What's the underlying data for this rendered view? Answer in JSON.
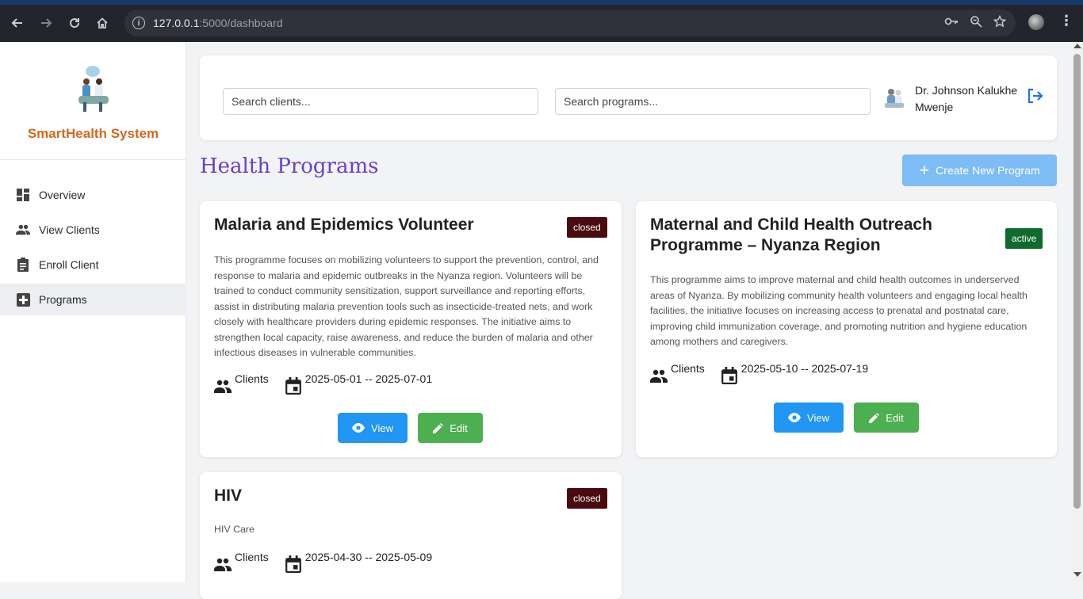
{
  "browser": {
    "url_host": "127.0.0.1",
    "url_rest": ":5000/dashboard",
    "icons": [
      "back-icon",
      "forward-icon",
      "reload-icon",
      "home-icon",
      "site-info-icon",
      "password-key-icon",
      "zoom-icon",
      "bookmark-star-icon",
      "profile-avatar",
      "chrome-menu-icon"
    ]
  },
  "sidebar": {
    "brand": "SmartHealth System",
    "items": [
      {
        "label": "Overview",
        "icon": "dashboard-icon"
      },
      {
        "label": "View Clients",
        "icon": "people-icon"
      },
      {
        "label": "Enroll Client",
        "icon": "clipboard-icon"
      },
      {
        "label": "Programs",
        "icon": "medical-plus-icon",
        "active": true
      }
    ]
  },
  "header": {
    "search_clients_placeholder": "Search clients...",
    "search_programs_placeholder": "Search programs...",
    "doctor_name": "Dr. Johnson Kalukhe Mwenje"
  },
  "main": {
    "title": "Health Programs",
    "create_button": "Create New Program",
    "view_label": "View",
    "edit_label": "Edit",
    "clients_label": "Clients",
    "programs": [
      {
        "name": "Malaria and Epidemics Volunteer",
        "status": "closed",
        "description": "This programme focuses on mobilizing volunteers to support the prevention, control, and response to malaria and epidemic outbreaks in the Nyanza region. Volunteers will be trained to conduct community sensitization, support surveillance and reporting efforts, assist in distributing malaria prevention tools such as insecticide-treated nets, and work closely with healthcare providers during epidemic responses. The initiative aims to strengthen local capacity, raise awareness, and reduce the burden of malaria and other infectious diseases in vulnerable communities.",
        "dates": "2025-05-01 -- 2025-07-01"
      },
      {
        "name": "Maternal and Child Health Outreach Programme – Nyanza Region",
        "status": "active",
        "description": "This programme aims to improve maternal and child health outcomes in underserved areas of Nyanza. By mobilizing community health volunteers and engaging local health facilities, the initiative focuses on increasing access to prenatal and postnatal care, improving child immunization coverage, and promoting nutrition and hygiene education among mothers and caregivers.",
        "dates": "2025-05-10 -- 2025-07-19"
      },
      {
        "name": "HIV",
        "status": "closed",
        "description": "HIV Care",
        "dates": "2025-04-30 -- 2025-05-09"
      }
    ]
  },
  "colors": {
    "brand": "#d2691e",
    "title": "#6a3fc8",
    "create_button": "#7dbcf5",
    "view_button": "#2196f3",
    "edit_button": "#4caf50",
    "badge_closed": "#4a0a0e",
    "badge_active": "#0e6a2d"
  }
}
